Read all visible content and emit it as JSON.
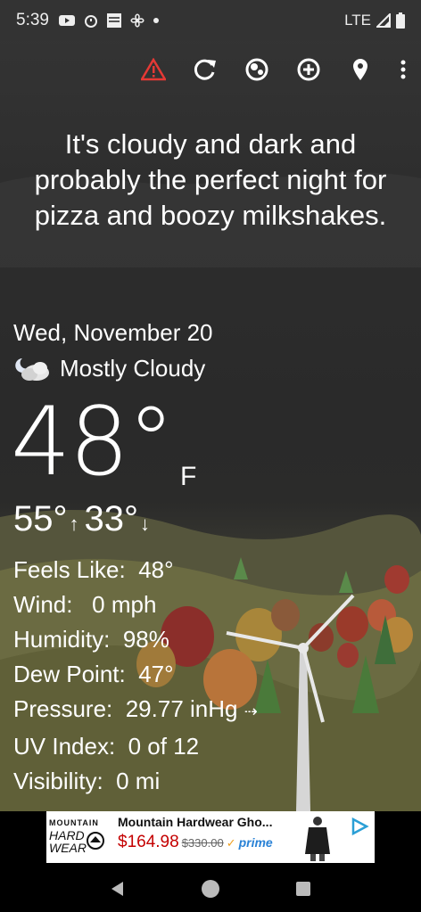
{
  "status_bar": {
    "time": "5:39",
    "network": "LTE",
    "notification_icons": [
      "youtube-icon",
      "alarm-icon",
      "weather-channel-icon",
      "fan-icon",
      "dot-icon"
    ]
  },
  "toolbar": {
    "actions": [
      "alert-icon",
      "refresh-icon",
      "theme-icon",
      "add-icon",
      "location-icon",
      "more-icon"
    ],
    "alert_color": "#e53935"
  },
  "headline": "It's cloudy and dark and probably the perfect night for pizza and boozy milkshakes.",
  "weather": {
    "date": "Wed, November 20",
    "condition": "Mostly Cloudy",
    "temperature": "48°",
    "unit": "F",
    "high": "55°",
    "low": "33°",
    "high_arrow": "↑",
    "low_arrow": "↓"
  },
  "details": [
    {
      "label": "Feels Like:",
      "value": "48°"
    },
    {
      "label": "Wind:",
      "value": "0 mph"
    },
    {
      "label": "Humidity:",
      "value": "98%"
    },
    {
      "label": "Dew Point:",
      "value": "47°"
    },
    {
      "label": "Pressure:",
      "value": "29.77 inHg"
    },
    {
      "label": "UV Index:",
      "value": "0 of 12"
    },
    {
      "label": "Visibility:",
      "value": "0 mi"
    }
  ],
  "pressure_trend": "⇢",
  "ad": {
    "brand_line1": "MOUNTAIN",
    "brand_line2": "HARD",
    "brand_line3": "WEAR",
    "title": "Mountain Hardwear Gho...",
    "price": "$164.98",
    "old_price": "$330.00",
    "prime": "prime"
  },
  "nav": [
    "back-icon",
    "home-icon",
    "recents-icon"
  ]
}
